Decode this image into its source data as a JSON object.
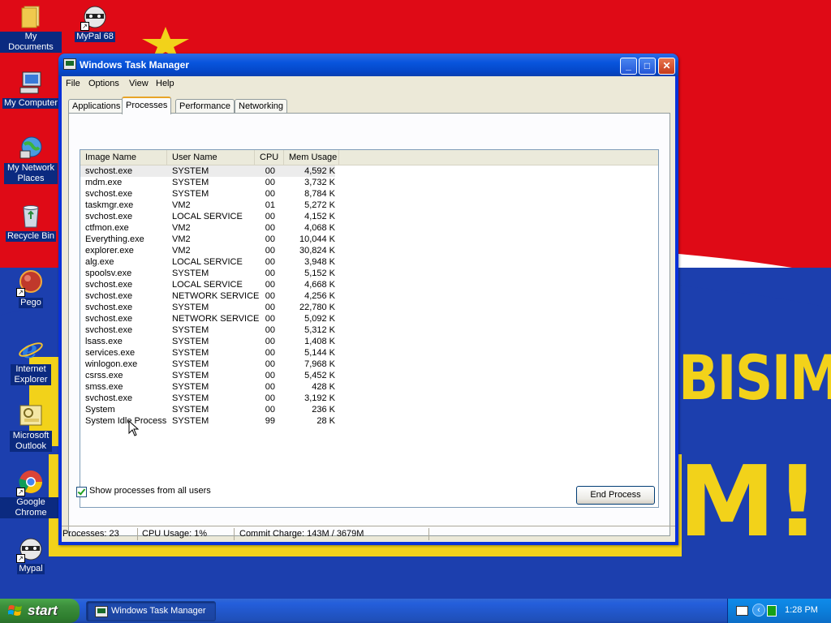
{
  "desktop": {
    "icons": [
      {
        "label": "My Documents"
      },
      {
        "label": "MyPal 68"
      },
      {
        "label": "My Computer"
      },
      {
        "label": "My Network Places"
      },
      {
        "label": "Recycle Bin"
      },
      {
        "label": "Pego"
      },
      {
        "label": "Internet Explorer"
      },
      {
        "label": "Microsoft Outlook"
      },
      {
        "label": "Google Chrome"
      },
      {
        "label": "Mypal"
      }
    ],
    "wallpaper_text": [
      "BISIM",
      "M!"
    ]
  },
  "window": {
    "title": "Windows Task Manager",
    "menu": [
      "File",
      "Options",
      "View",
      "Help"
    ],
    "tabs": [
      "Applications",
      "Processes",
      "Performance",
      "Networking"
    ],
    "active_tab": "Processes",
    "columns": [
      "Image Name",
      "User Name",
      "CPU",
      "Mem Usage"
    ],
    "processes": [
      {
        "name": "svchost.exe",
        "user": "SYSTEM",
        "cpu": "00",
        "mem": "4,592 K"
      },
      {
        "name": "mdm.exe",
        "user": "SYSTEM",
        "cpu": "00",
        "mem": "3,732 K"
      },
      {
        "name": "svchost.exe",
        "user": "SYSTEM",
        "cpu": "00",
        "mem": "8,784 K"
      },
      {
        "name": "taskmgr.exe",
        "user": "VM2",
        "cpu": "01",
        "mem": "5,272 K"
      },
      {
        "name": "svchost.exe",
        "user": "LOCAL SERVICE",
        "cpu": "00",
        "mem": "4,152 K"
      },
      {
        "name": "ctfmon.exe",
        "user": "VM2",
        "cpu": "00",
        "mem": "4,068 K"
      },
      {
        "name": "Everything.exe",
        "user": "VM2",
        "cpu": "00",
        "mem": "10,044 K"
      },
      {
        "name": "explorer.exe",
        "user": "VM2",
        "cpu": "00",
        "mem": "30,824 K"
      },
      {
        "name": "alg.exe",
        "user": "LOCAL SERVICE",
        "cpu": "00",
        "mem": "3,948 K"
      },
      {
        "name": "spoolsv.exe",
        "user": "SYSTEM",
        "cpu": "00",
        "mem": "5,152 K"
      },
      {
        "name": "svchost.exe",
        "user": "LOCAL SERVICE",
        "cpu": "00",
        "mem": "4,668 K"
      },
      {
        "name": "svchost.exe",
        "user": "NETWORK SERVICE",
        "cpu": "00",
        "mem": "4,256 K"
      },
      {
        "name": "svchost.exe",
        "user": "SYSTEM",
        "cpu": "00",
        "mem": "22,780 K"
      },
      {
        "name": "svchost.exe",
        "user": "NETWORK SERVICE",
        "cpu": "00",
        "mem": "5,092 K"
      },
      {
        "name": "svchost.exe",
        "user": "SYSTEM",
        "cpu": "00",
        "mem": "5,312 K"
      },
      {
        "name": "lsass.exe",
        "user": "SYSTEM",
        "cpu": "00",
        "mem": "1,408 K"
      },
      {
        "name": "services.exe",
        "user": "SYSTEM",
        "cpu": "00",
        "mem": "5,144 K"
      },
      {
        "name": "winlogon.exe",
        "user": "SYSTEM",
        "cpu": "00",
        "mem": "7,968 K"
      },
      {
        "name": "csrss.exe",
        "user": "SYSTEM",
        "cpu": "00",
        "mem": "5,452 K"
      },
      {
        "name": "smss.exe",
        "user": "SYSTEM",
        "cpu": "00",
        "mem": "428 K"
      },
      {
        "name": "svchost.exe",
        "user": "SYSTEM",
        "cpu": "00",
        "mem": "3,192 K"
      },
      {
        "name": "System",
        "user": "SYSTEM",
        "cpu": "00",
        "mem": "236 K"
      },
      {
        "name": "System Idle Process",
        "user": "SYSTEM",
        "cpu": "99",
        "mem": "28 K"
      }
    ],
    "show_all_users_label": "Show processes from all users",
    "show_all_users_checked": true,
    "end_process_label": "End Process",
    "status": {
      "processes": "Processes: 23",
      "cpu": "CPU Usage: 1%",
      "commit": "Commit Charge: 143M / 3679M"
    }
  },
  "taskbar": {
    "start_label": "start",
    "task_button_label": "Windows Task Manager",
    "tray_arrow": "‹",
    "clock": "1:28 PM"
  }
}
